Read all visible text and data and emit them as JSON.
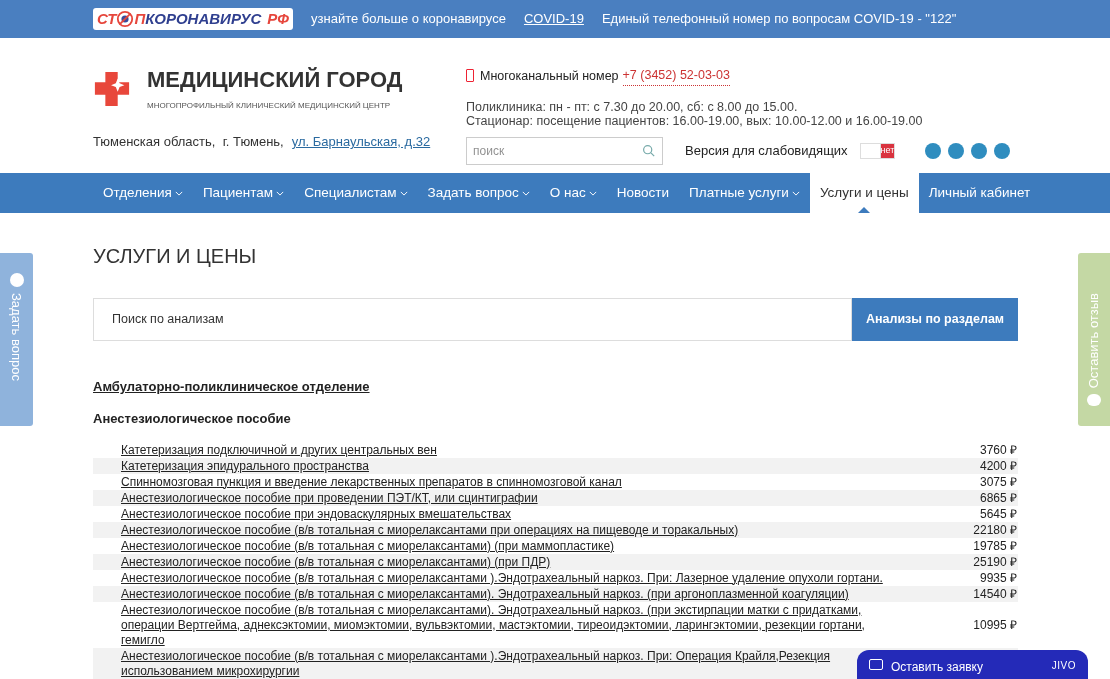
{
  "top_bar": {
    "logo": {
      "part_1": "СТ",
      "part_2": "П",
      "part_3": "КОРОНАВИРУС",
      "part_4": "РФ"
    },
    "info": "узнайте больше о коронавирусе",
    "link": "COVID-19",
    "hotline": "Единый телефонный номер по вопросам COVID-19 - \"122\""
  },
  "header": {
    "brand": "МЕДИЦИНСКИЙ ГОРОД",
    "tagline": "МНОГОПРОФИЛЬНЫЙ КЛИНИЧЕСКИЙ МЕДИЦИНСКИЙ ЦЕНТР",
    "address": "Тюменская область,  г. Тюмень,",
    "address_link": "ул. Барнаульская, д.32",
    "phone_label": "Многоканальный номер",
    "phone": "+7 (3452) 52-03-03",
    "hours": [
      "Поликлиника: пн - пт: с 7.30 до 20.00, сб: с 8.00 до 15.00.",
      "Стационар: посещение пациентов: 16.00-19.00, вых: 10.00-12.00 и 16.00-19.00"
    ],
    "search": {
      "placeholder": "поиск"
    },
    "accessibility": {
      "label": "Версия для слабовидящих",
      "toggle": "нет",
      "on": false
    }
  },
  "nav": [
    {
      "label": "Отделения",
      "dropdown": true,
      "selected": false
    },
    {
      "label": "Пациентам",
      "dropdown": true,
      "selected": false
    },
    {
      "label": "Специалистам",
      "dropdown": true,
      "selected": false
    },
    {
      "label": "Задать вопрос",
      "dropdown": true,
      "selected": false
    },
    {
      "label": "О нас",
      "dropdown": true,
      "selected": false
    },
    {
      "label": "Новости",
      "dropdown": false,
      "selected": false
    },
    {
      "label": "Платные услуги",
      "dropdown": true,
      "selected": false
    },
    {
      "label": "Услуги и цены",
      "dropdown": false,
      "selected": true
    },
    {
      "label": "Личный кабинет",
      "dropdown": false,
      "selected": false
    }
  ],
  "page_title": "УСЛУГИ И ЦЕНЫ",
  "analysis_search": {
    "placeholder": "Поиск по анализам",
    "button": "Анализы по разделам"
  },
  "section": "Амбулаторно-поликлиническое отделение",
  "subsection": "Анестезиологическое пособие",
  "rows": [
    {
      "name": "Катетеризация подключичной и других центральных вен",
      "price": "3760 ₽"
    },
    {
      "name": "Катетеризация эпидурального пространства",
      "price": "4200 ₽"
    },
    {
      "name": "Спинномозговая пункция и введение лекарственных препаратов в спинномозговой канал",
      "price": "3075 ₽"
    },
    {
      "name": "Анестезиологическое пособие при проведении ПЭТ/КТ, или сцинтиграфии",
      "price": "6865 ₽"
    },
    {
      "name": "Анестезиологическое пособие при эндоваскулярных вмешательствах",
      "price": "5645 ₽"
    },
    {
      "name": "Анестезиологическое пособие (в/в тотальная с миорелаксантами при операциях на пищеводе и торакальных)",
      "price": "22180 ₽"
    },
    {
      "name": "Анестезиологическое пособие (в/в тотальная с миорелаксантами) (при маммопластике)",
      "price": "19785 ₽"
    },
    {
      "name": "Анестезиологическое пособие (в/в тотальная с миорелаксантами) (при ПДР)",
      "price": "25190 ₽"
    },
    {
      "name": "Анестезиологическое пособие (в/в тотальная с миорелаксантами ).Эндотрахеальный наркоз. При: Лазерное удаление опухоли гортани.",
      "price": "9935 ₽"
    },
    {
      "name": "Анестезиологическое пособие (в/в тотальная с миорелаксантами). Эндотрахеальный наркоз. (при аргоноплазменной коагуляции)",
      "price": "14540 ₽"
    },
    {
      "name": "Анестезиологическое пособие (в/в тотальная с миорелаксантами). Эндотрахеальный наркоз. (при экстирпации матки с придатками, операции Вертгейма, аднексэктомии, миомэктомии, вульвэктомии, мастэктомии, тиреоидэктомии, ларингэктомии, резекции гортани, гемигло",
      "price": "10995 ₽"
    },
    {
      "name": "Анестезиологическое пособие (в/в тотальная с миорелаксантами ).Эндотрахеальный наркоз. При: Операция Крайля,Резекция",
      "name_line_2": "использованием микрохирургии"
    }
  ],
  "side_tabs": {
    "left": "Задать вопрос",
    "right": "Оставить отзыв"
  },
  "chat_widget": {
    "label": "Оставить заявку",
    "brand": "JIVO"
  }
}
